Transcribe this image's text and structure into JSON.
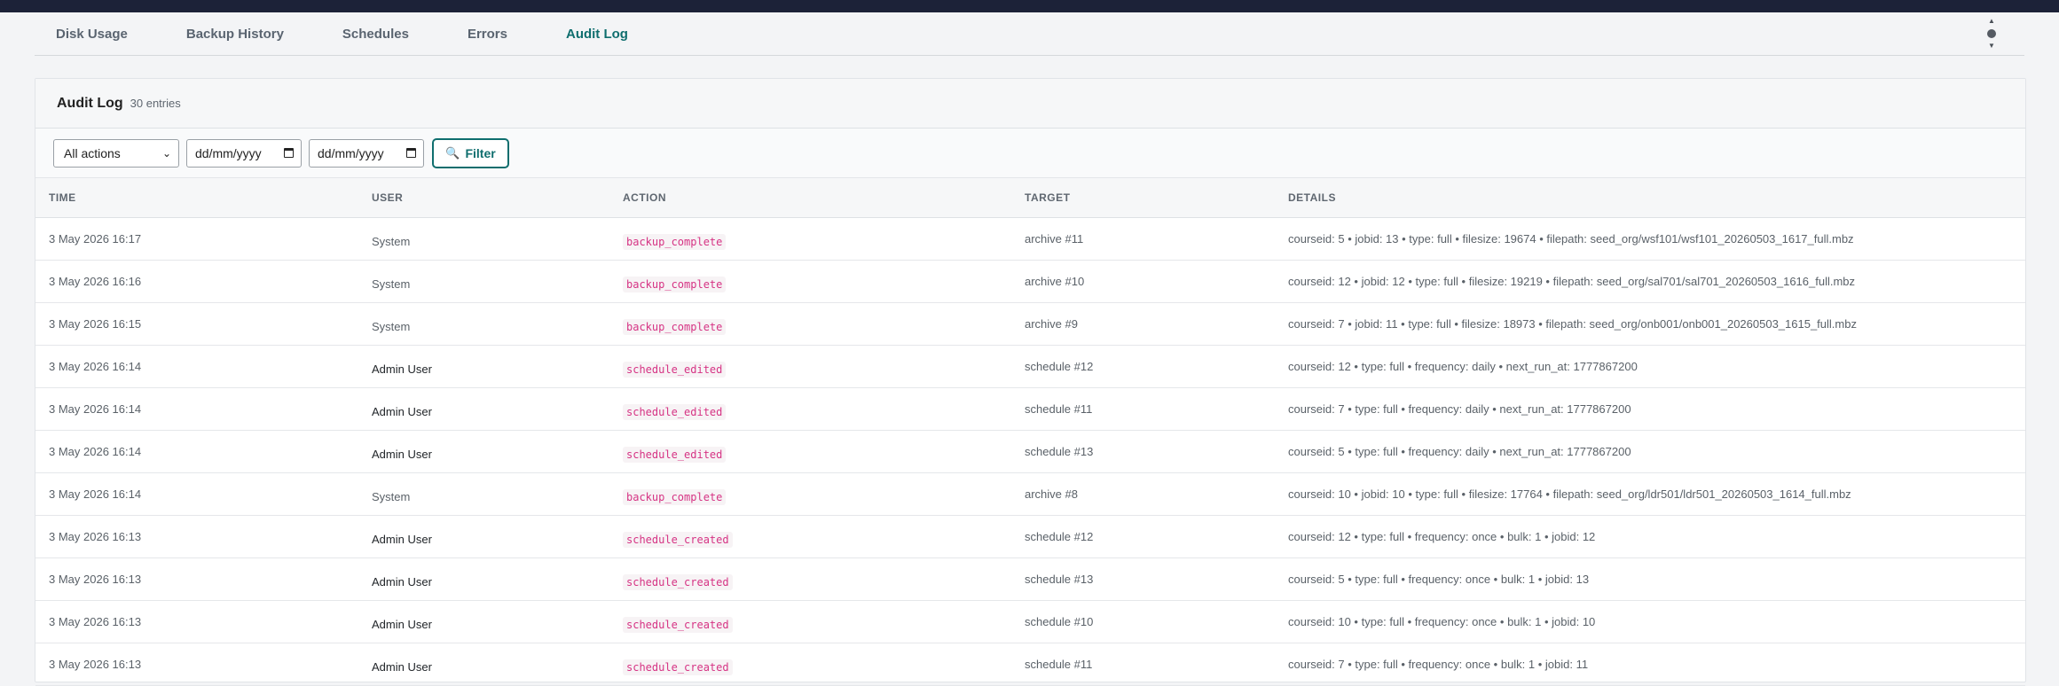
{
  "tabs": [
    {
      "label": "Disk Usage",
      "active": false
    },
    {
      "label": "Backup History",
      "active": false
    },
    {
      "label": "Schedules",
      "active": false
    },
    {
      "label": "Errors",
      "active": false
    },
    {
      "label": "Audit Log",
      "active": true
    }
  ],
  "card": {
    "title": "Audit Log",
    "count": "30 entries"
  },
  "filters": {
    "action_select": "All actions",
    "date_from": "dd/mm/yyyy",
    "date_to": "dd/mm/yyyy",
    "filter_button": "Filter"
  },
  "columns": [
    "TIME",
    "USER",
    "ACTION",
    "TARGET",
    "DETAILS"
  ],
  "rows": [
    {
      "time": "3 May 2026 16:17",
      "user": "System",
      "action": "backup_complete",
      "target": "archive #11",
      "details": "courseid: 5 • jobid: 13 • type: full • filesize: 19674 • filepath: seed_org/wsf101/wsf101_20260503_1617_full.mbz"
    },
    {
      "time": "3 May 2026 16:16",
      "user": "System",
      "action": "backup_complete",
      "target": "archive #10",
      "details": "courseid: 12 • jobid: 12 • type: full • filesize: 19219 • filepath: seed_org/sal701/sal701_20260503_1616_full.mbz"
    },
    {
      "time": "3 May 2026 16:15",
      "user": "System",
      "action": "backup_complete",
      "target": "archive #9",
      "details": "courseid: 7 • jobid: 11 • type: full • filesize: 18973 • filepath: seed_org/onb001/onb001_20260503_1615_full.mbz"
    },
    {
      "time": "3 May 2026 16:14",
      "user": "Admin User",
      "action": "schedule_edited",
      "target": "schedule #12",
      "details": "courseid: 12 • type: full • frequency: daily • next_run_at: 1777867200"
    },
    {
      "time": "3 May 2026 16:14",
      "user": "Admin User",
      "action": "schedule_edited",
      "target": "schedule #11",
      "details": "courseid: 7 • type: full • frequency: daily • next_run_at: 1777867200"
    },
    {
      "time": "3 May 2026 16:14",
      "user": "Admin User",
      "action": "schedule_edited",
      "target": "schedule #13",
      "details": "courseid: 5 • type: full • frequency: daily • next_run_at: 1777867200"
    },
    {
      "time": "3 May 2026 16:14",
      "user": "System",
      "action": "backup_complete",
      "target": "archive #8",
      "details": "courseid: 10 • jobid: 10 • type: full • filesize: 17764 • filepath: seed_org/ldr501/ldr501_20260503_1614_full.mbz"
    },
    {
      "time": "3 May 2026 16:13",
      "user": "Admin User",
      "action": "schedule_created",
      "target": "schedule #12",
      "details": "courseid: 12 • type: full • frequency: once • bulk: 1 • jobid: 12"
    },
    {
      "time": "3 May 2026 16:13",
      "user": "Admin User",
      "action": "schedule_created",
      "target": "schedule #13",
      "details": "courseid: 5 • type: full • frequency: once • bulk: 1 • jobid: 13"
    },
    {
      "time": "3 May 2026 16:13",
      "user": "Admin User",
      "action": "schedule_created",
      "target": "schedule #10",
      "details": "courseid: 10 • type: full • frequency: once • bulk: 1 • jobid: 10"
    },
    {
      "time": "3 May 2026 16:13",
      "user": "Admin User",
      "action": "schedule_created",
      "target": "schedule #11",
      "details": "courseid: 7 • type: full • frequency: once • bulk: 1 • jobid: 11"
    }
  ],
  "colors": {
    "accent": "#0f6e6e",
    "action_code": "#d63384",
    "topbar": "#1c2238"
  },
  "icons": {
    "filter": "search-icon",
    "menu": "kebab-menu-icon",
    "date": "calendar-icon"
  }
}
